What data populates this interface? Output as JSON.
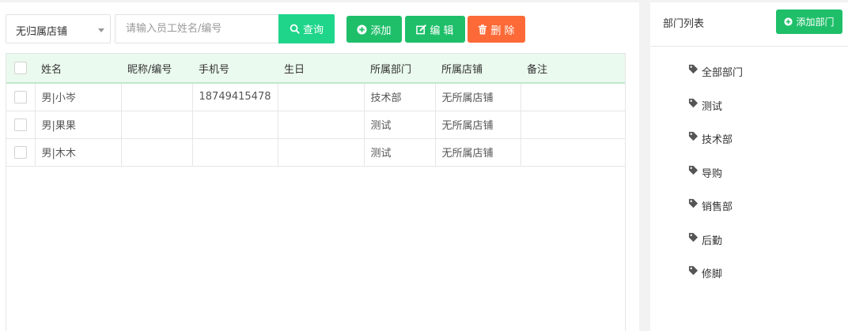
{
  "toolbar": {
    "store_select": "无归属店铺",
    "search_placeholder": "请输入员工姓名/编号",
    "query_label": "查询",
    "add_label": "添加",
    "edit_label": "编 辑",
    "delete_label": "删 除"
  },
  "table": {
    "headers": [
      "姓名",
      "昵称/编号",
      "手机号",
      "生日",
      "所属部门",
      "所属店铺",
      "备注"
    ],
    "rows": [
      {
        "name": "男|小岑",
        "nickname": "",
        "phone": "18749415478",
        "birthday": "",
        "dept": "技术部",
        "store": "无所属店铺",
        "note": ""
      },
      {
        "name": "男|果果",
        "nickname": "",
        "phone": "",
        "birthday": "",
        "dept": "测试",
        "store": "无所属店铺",
        "note": ""
      },
      {
        "name": "男|木木",
        "nickname": "",
        "phone": "",
        "birthday": "",
        "dept": "测试",
        "store": "无所属店铺",
        "note": ""
      }
    ]
  },
  "sidebar": {
    "title": "部门列表",
    "add_dept_label": "添加部门",
    "departments": [
      "全部部门",
      "测试",
      "技术部",
      "导购",
      "销售部",
      "后勤",
      "修脚"
    ]
  },
  "icons": {
    "query": "search-icon",
    "add": "plus-circle-icon",
    "edit": "edit-icon",
    "delete": "trash-icon",
    "dept": "tag-icon"
  },
  "colors": {
    "query_button": "#1ed58a",
    "primary_button": "#1fbf6a",
    "delete_button": "#fd6a37",
    "table_header_bg": "#ebfaee"
  }
}
